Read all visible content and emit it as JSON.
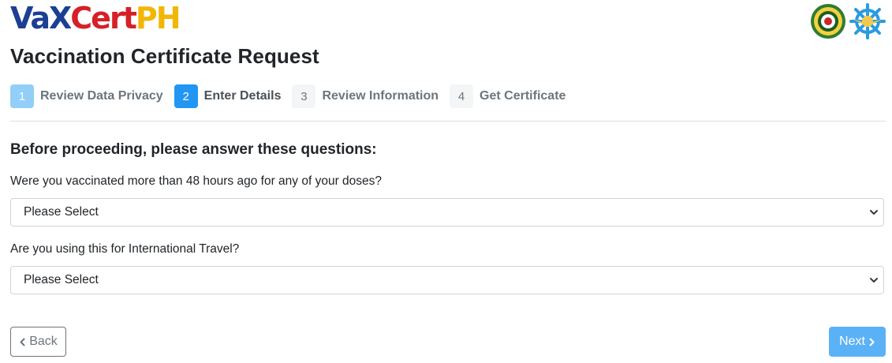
{
  "header": {
    "logo_parts": [
      "Va",
      "X",
      "Cert",
      "PH"
    ],
    "seal_icons": [
      "doh-seal-icon",
      "dict-seal-icon"
    ]
  },
  "page_title": "Vaccination Certificate Request",
  "steps": [
    {
      "num": "1",
      "label": "Review Data Privacy",
      "state": "done"
    },
    {
      "num": "2",
      "label": "Enter Details",
      "state": "active"
    },
    {
      "num": "3",
      "label": "Review Information",
      "state": "pending"
    },
    {
      "num": "4",
      "label": "Get Certificate",
      "state": "pending"
    }
  ],
  "form": {
    "heading": "Before proceeding, please answer these questions:",
    "questions": [
      {
        "label": "Were you vaccinated more than 48 hours ago for any of your doses?",
        "selected": "Please Select"
      },
      {
        "label": "Are you using this for International Travel?",
        "selected": "Please Select"
      }
    ]
  },
  "buttons": {
    "back_label": "Back",
    "next_label": "Next"
  },
  "colors": {
    "accent": "#2196f3",
    "next_button": "#5bb1f5",
    "logo_blue": "#1c3f94",
    "logo_red": "#d62027",
    "logo_yellow": "#f2b705"
  }
}
